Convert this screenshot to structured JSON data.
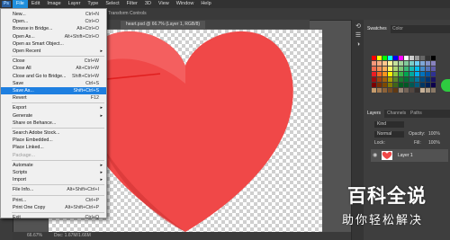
{
  "menubar": {
    "logo": "Ps",
    "items": [
      "File",
      "Edit",
      "Image",
      "Layer",
      "Type",
      "Select",
      "Filter",
      "3D",
      "View",
      "Window",
      "Help"
    ]
  },
  "options_bar": {
    "text": "Transform Controls"
  },
  "document": {
    "tab": "heart.psd @ 66.7% (Layer 1, RGB/8)",
    "zoom": "66.67%",
    "doc_info": "Doc: 1.67M/1.66M"
  },
  "file_menu": {
    "items": [
      {
        "label": "New...",
        "shortcut": "Ctrl+N"
      },
      {
        "label": "Open...",
        "shortcut": "Ctrl+O"
      },
      {
        "label": "Browse in Bridge...",
        "shortcut": "Alt+Ctrl+O"
      },
      {
        "label": "Open As...",
        "shortcut": "Alt+Shift+Ctrl+O"
      },
      {
        "label": "Open as Smart Object...",
        "shortcut": ""
      },
      {
        "label": "Open Recent",
        "shortcut": "",
        "submenu": true
      },
      {
        "sep": true
      },
      {
        "label": "Close",
        "shortcut": "Ctrl+W"
      },
      {
        "label": "Close All",
        "shortcut": "Alt+Ctrl+W"
      },
      {
        "label": "Close and Go to Bridge...",
        "shortcut": "Shift+Ctrl+W"
      },
      {
        "label": "Save",
        "shortcut": "Ctrl+S"
      },
      {
        "label": "Save As...",
        "shortcut": "Shift+Ctrl+S",
        "highlight": true
      },
      {
        "label": "Revert",
        "shortcut": "F12"
      },
      {
        "sep": true
      },
      {
        "label": "Export",
        "shortcut": "",
        "submenu": true
      },
      {
        "label": "Generate",
        "shortcut": "",
        "submenu": true
      },
      {
        "label": "Share on Behance...",
        "shortcut": ""
      },
      {
        "sep": true
      },
      {
        "label": "Search Adobe Stock...",
        "shortcut": ""
      },
      {
        "label": "Place Embedded...",
        "shortcut": ""
      },
      {
        "label": "Place Linked...",
        "shortcut": ""
      },
      {
        "label": "Package...",
        "shortcut": "",
        "disabled": true
      },
      {
        "sep": true
      },
      {
        "label": "Automate",
        "shortcut": "",
        "submenu": true
      },
      {
        "label": "Scripts",
        "shortcut": "",
        "submenu": true
      },
      {
        "label": "Import",
        "shortcut": "",
        "submenu": true
      },
      {
        "sep": true
      },
      {
        "label": "File Info...",
        "shortcut": "Alt+Shift+Ctrl+I"
      },
      {
        "sep": true
      },
      {
        "label": "Print...",
        "shortcut": "Ctrl+P"
      },
      {
        "label": "Print One Copy",
        "shortcut": "Alt+Shift+Ctrl+P"
      },
      {
        "sep": true
      },
      {
        "label": "Exit",
        "shortcut": "Ctrl+Q"
      }
    ]
  },
  "panels": {
    "swatches_tabs": [
      "Swatches",
      "Color"
    ],
    "layers_tabs": [
      "Layers",
      "Channels",
      "Paths"
    ],
    "kind_label": "Kind",
    "blend_mode": "Normal",
    "opacity_label": "Opacity:",
    "opacity_value": "100%",
    "lock_label": "Lock:",
    "fill_label": "Fill:",
    "fill_value": "100%",
    "layer_name": "Layer 1"
  },
  "watermark": {
    "line1": "百科全说",
    "line2": "助你轻松解决"
  },
  "colors": {
    "menu_highlight": "#1e7fe0",
    "heart": "#f04848",
    "arrow": "#e02020"
  }
}
